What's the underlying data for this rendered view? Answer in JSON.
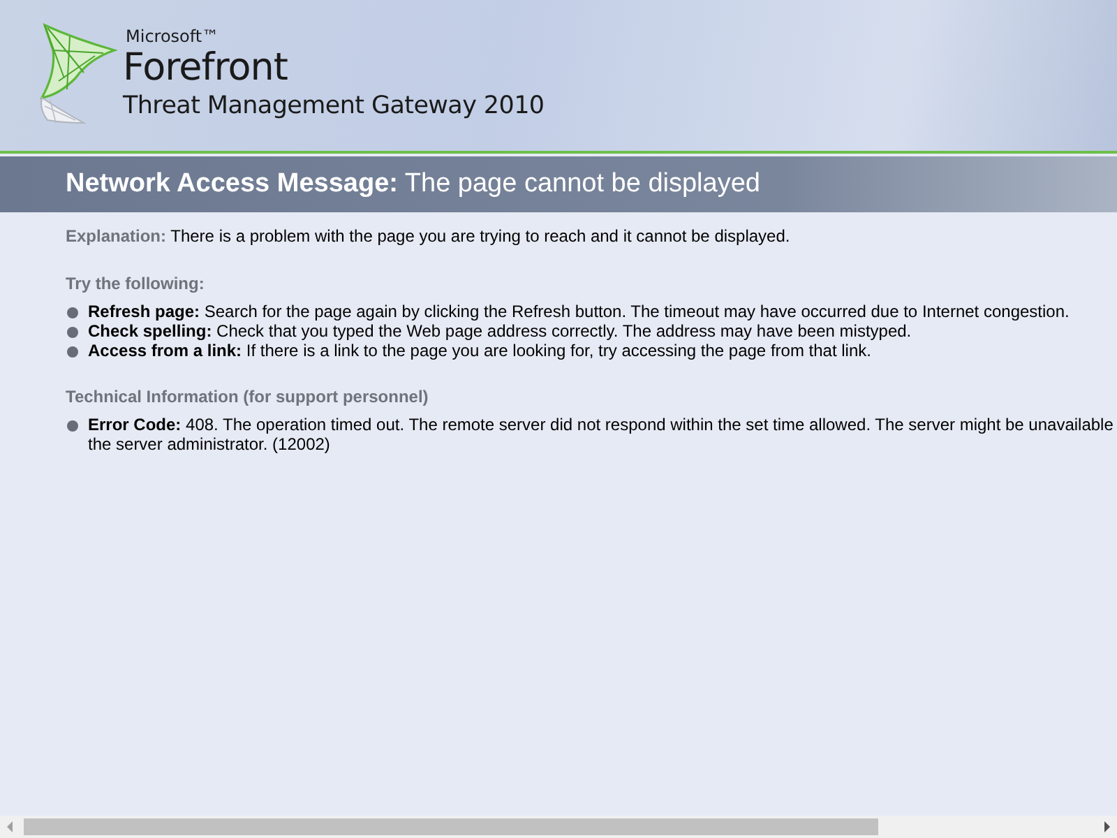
{
  "header": {
    "brand": "Microsoft™",
    "product": "Forefront",
    "subtitle": "Threat Management Gateway 2010"
  },
  "title_bar": {
    "label": "Network Access Message:",
    "text": "The page cannot be displayed"
  },
  "explanation": {
    "label": "Explanation:",
    "text": "There is a problem with the page you are trying to reach and it cannot be displayed."
  },
  "suggestions": {
    "heading": "Try the following:",
    "items": [
      {
        "label": "Refresh page:",
        "text": "Search for the page again by clicking the Refresh button. The timeout may have occurred due to Internet congestion."
      },
      {
        "label": "Check spelling:",
        "text": "Check that you typed the Web page address correctly. The address may have been mistyped."
      },
      {
        "label": "Access from a link:",
        "text": "If there is a link to the page you are looking for, try accessing the page from that link."
      }
    ]
  },
  "technical": {
    "heading": "Technical Information (for support personnel)",
    "items": [
      {
        "label": "Error Code:",
        "lines": [
          "408. The operation timed out. The remote server did not respond within the set time allowed. The server might be unavailable",
          "the server administrator. (12002)"
        ]
      }
    ]
  }
}
